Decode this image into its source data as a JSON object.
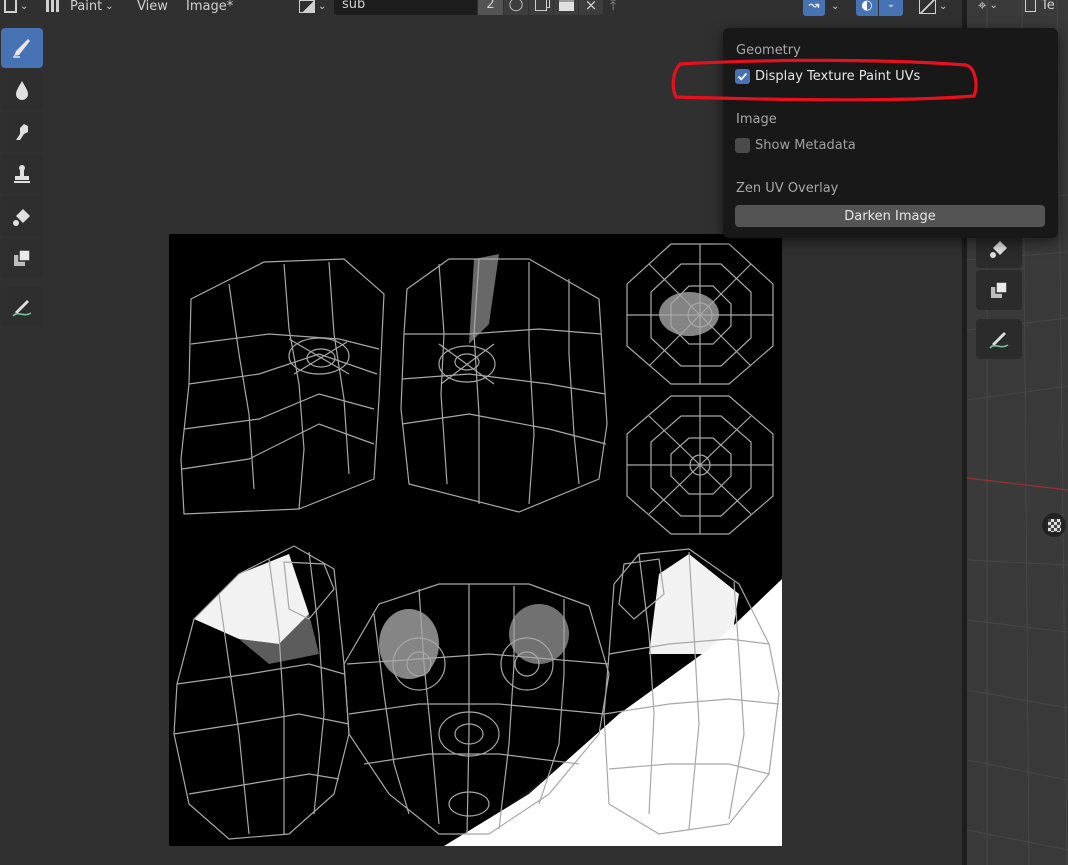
{
  "header": {
    "mode_label": "Paint",
    "menu_view": "View",
    "menu_image": "Image*",
    "image_name": "sub",
    "user_count": "2"
  },
  "popover": {
    "geometry_heading": "Geometry",
    "display_texture_paint_uvs_label": "Display Texture Paint UVs",
    "display_texture_paint_uvs_checked": true,
    "image_heading": "Image",
    "show_metadata_label": "Show Metadata",
    "show_metadata_checked": false,
    "zen_uv_heading": "Zen UV Overlay",
    "darken_image_label": "Darken Image"
  },
  "right_header": {
    "tab_text": "Te"
  },
  "toolbar": {
    "tools": [
      "draw-brush-icon",
      "soften-icon",
      "smear-icon",
      "clone-stamp-icon",
      "fill-bucket-icon",
      "mask-icon",
      "annotate-icon"
    ],
    "active": "draw-brush-icon"
  },
  "colors": {
    "accent": "#4772b3",
    "annotation": "#e8101e",
    "background": "#303030",
    "popover": "#181818"
  }
}
